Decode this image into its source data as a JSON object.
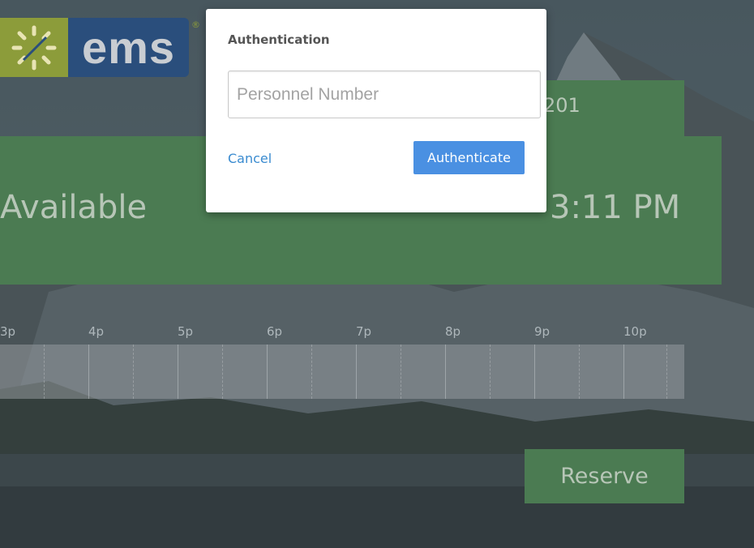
{
  "logo": {
    "text": "ems",
    "registered_mark": "®",
    "icon": "ems-sun-icon"
  },
  "room": {
    "name_partial": "201"
  },
  "status": {
    "label": "Available",
    "clock": "3:11 PM"
  },
  "timeline": {
    "hours": [
      "3p",
      "4p",
      "5p",
      "6p",
      "7p",
      "8p",
      "9p",
      "10p"
    ]
  },
  "reserve_button": {
    "label": "Reserve"
  },
  "auth_modal": {
    "title": "Authentication",
    "input_placeholder": "Personnel Number",
    "input_value": "",
    "cancel_label": "Cancel",
    "authenticate_label": "Authenticate"
  },
  "colors": {
    "status_green": "#4b7b52",
    "logo_olive": "#8c9c3a",
    "logo_navy": "#2a4e7c",
    "auth_button_blue": "#4a90e2",
    "link_blue": "#3a8bd0"
  }
}
